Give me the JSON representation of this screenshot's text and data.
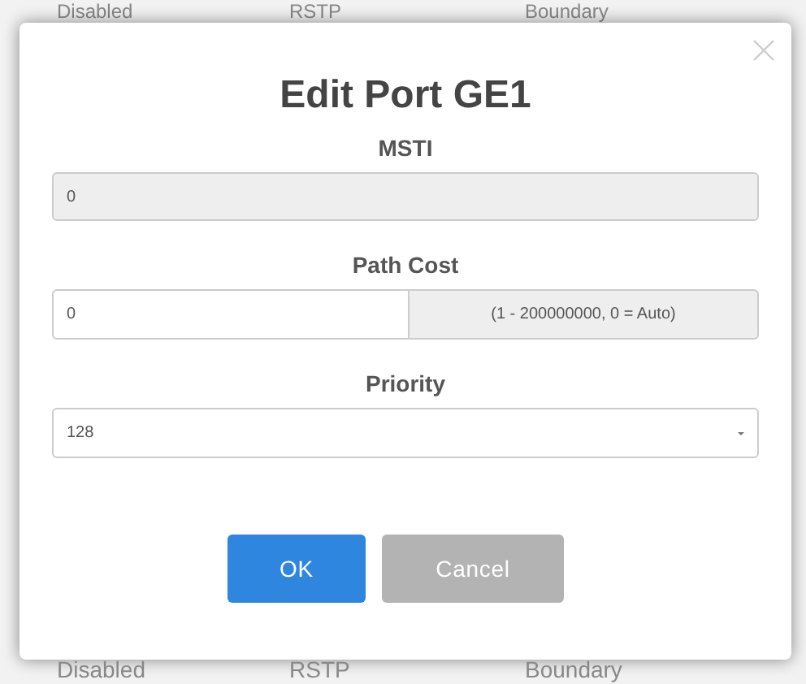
{
  "background_rows": [
    {
      "cells": [
        "Disabled",
        "RSTP",
        "Boundary"
      ]
    },
    {
      "cells": [
        "Disabled",
        "RSTP",
        "Boundary"
      ]
    }
  ],
  "dialog": {
    "title": "Edit Port GE1",
    "fields": [
      {
        "kind": "readonly",
        "label": "MSTI",
        "value": "0"
      },
      {
        "kind": "addon",
        "label": "Path Cost",
        "value": "0",
        "addon": "(1 - 200000000, 0 = Auto)"
      },
      {
        "kind": "select",
        "label": "Priority",
        "value": "128"
      }
    ],
    "buttons": [
      {
        "label": "OK",
        "kind": "primary"
      },
      {
        "label": "Cancel",
        "kind": "secondary"
      }
    ]
  }
}
